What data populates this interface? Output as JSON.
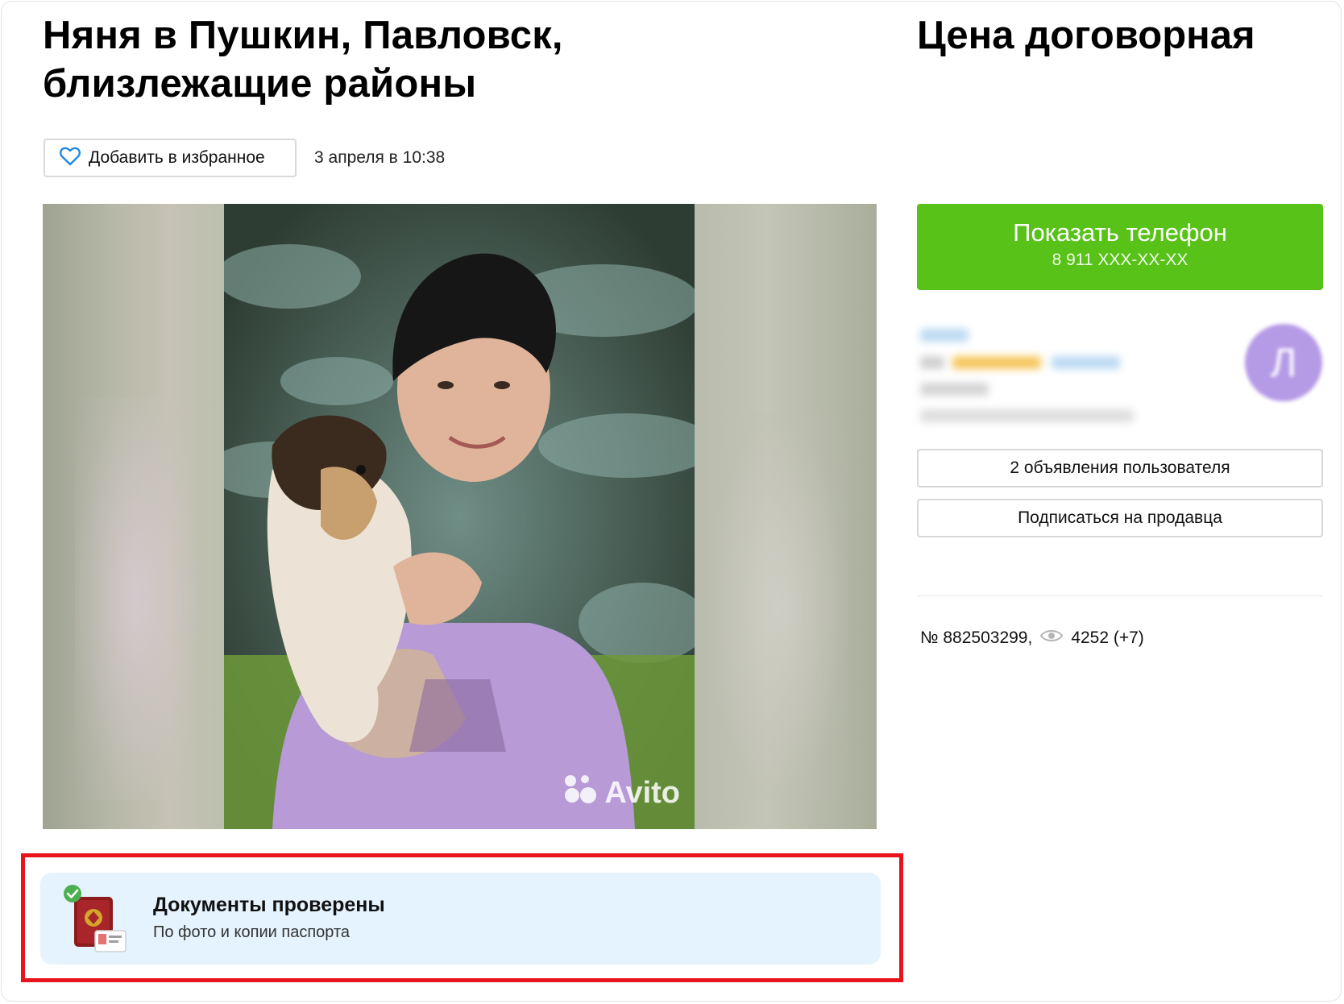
{
  "listing": {
    "title": "Няня в Пушкин, Павловск, близлежащие районы",
    "price": "Цена договорная",
    "favorite_label": "Добавить в избранное",
    "date": "3 апреля в 10:38",
    "watermark": "Avito"
  },
  "contact": {
    "show_phone_label": "Показать телефон",
    "phone_masked": "8 911 XXX-XX-XX",
    "user_ads_label": "2 объявления пользователя",
    "subscribe_label": "Подписаться на продавца"
  },
  "stats": {
    "ad_number": "№ 882503299,",
    "views": "4252 (+7)"
  },
  "verification": {
    "title": "Документы проверены",
    "subtitle": "По фото и копии паспорта"
  },
  "colors": {
    "phone_button": "#58c218",
    "verification_bg": "#e4f3fd",
    "highlight_border": "#e8141b",
    "heart_icon": "#1e88e5"
  },
  "icons": [
    "heart-icon",
    "eye-icon",
    "passport-icon",
    "check-icon",
    "avito-logo-icon"
  ]
}
